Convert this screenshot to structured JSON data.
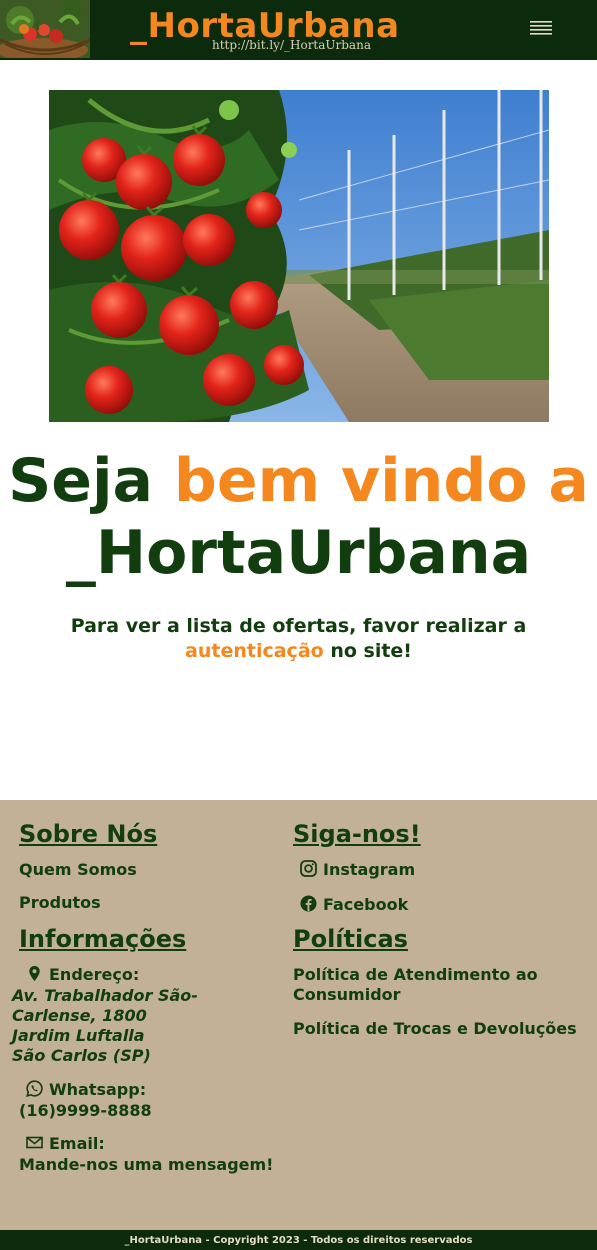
{
  "header": {
    "brand": "_HortaUrbana",
    "brand_link": "http://bit.ly/_HortaUrbana",
    "menu_icon": "hamburger-icon",
    "colors": {
      "bar": "#0c2b0c",
      "brand": "#f5871f"
    }
  },
  "hero": {
    "image": "tomato-plants-photo"
  },
  "welcome": {
    "part1": "Seja ",
    "part2": "bem vindo a",
    "part3": "_HortaUrbana"
  },
  "notice": {
    "text_before": "Para ver a lista de ofertas, favor realizar a ",
    "link": "autenticação",
    "text_after": " no site!"
  },
  "footer": {
    "about": {
      "title": "Sobre Nós",
      "links": [
        "Quem Somos",
        "Produtos"
      ]
    },
    "follow": {
      "title": "Siga-nos!",
      "links": [
        {
          "label": "Instagram",
          "icon": "instagram-icon"
        },
        {
          "label": "Facebook",
          "icon": "facebook-icon"
        }
      ]
    },
    "info": {
      "title": "Informações",
      "address_label": "Endereço:",
      "address_lines": [
        "Av. Trabalhador São-Carlense, 1800",
        "Jardim Luftalla",
        "São Carlos (SP)"
      ],
      "whatsapp_label": "Whatsapp:",
      "whatsapp_value": "(16)9999-8888",
      "email_label": "Email:",
      "email_value": "Mande-nos uma mensagem!"
    },
    "policies": {
      "title": "Políticas",
      "links": [
        "Política de Atendimento ao Consumidor",
        "Política de Trocas e Devoluções"
      ]
    },
    "copyright": "_HortaUrbana - Copyright 2023 - Todos os direitos reservados",
    "colors": {
      "background": "#c2b194",
      "text": "#113d0f"
    }
  }
}
